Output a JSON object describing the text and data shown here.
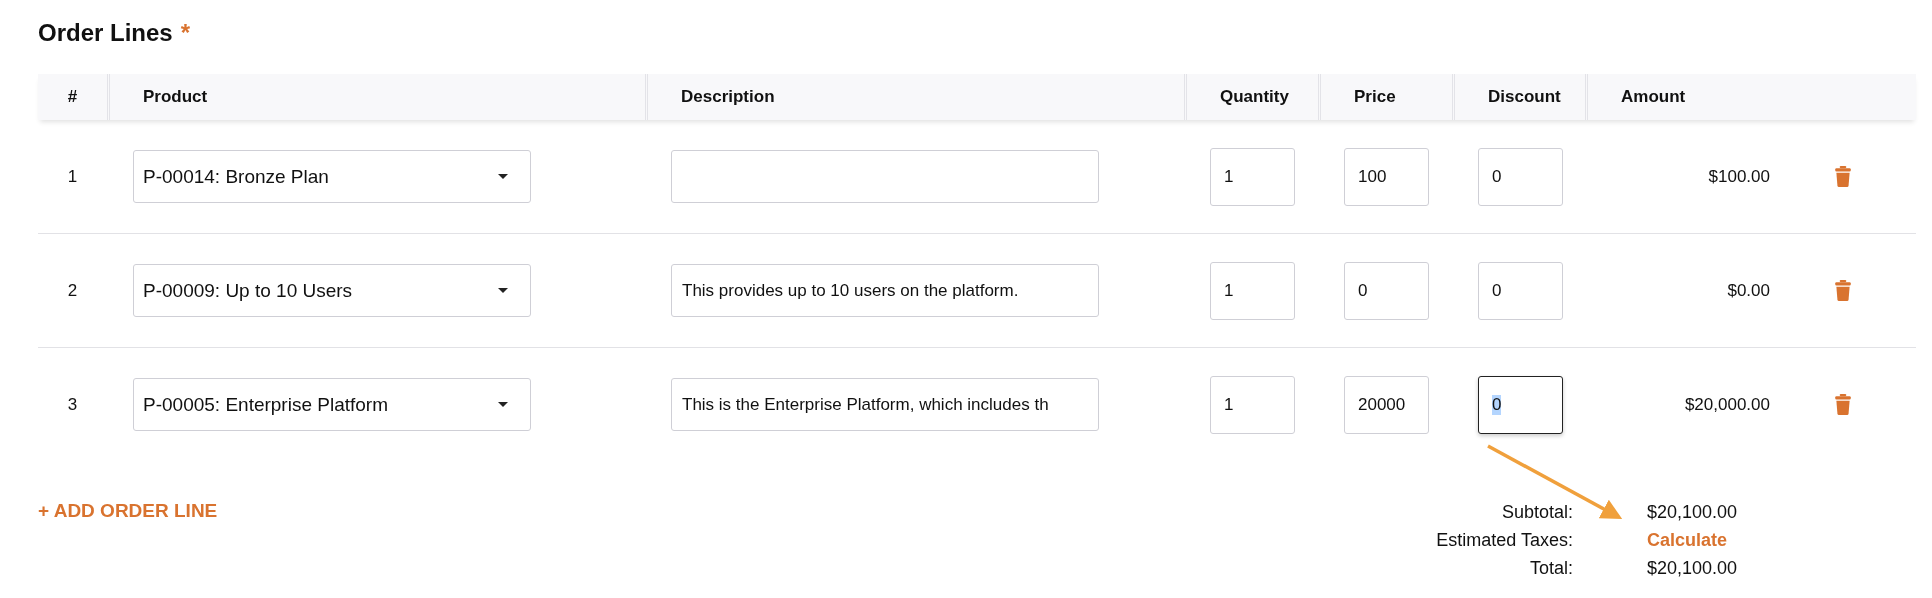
{
  "section": {
    "title": "Order Lines",
    "required_mark": "*"
  },
  "table": {
    "columns": [
      "#",
      "Product",
      "Description",
      "Quantity",
      "Price",
      "Discount",
      "Amount"
    ],
    "rows": [
      {
        "number": "1",
        "product": "P-00014: Bronze Plan",
        "quantity": "1",
        "price": "100",
        "discount": "0",
        "discount_focused": false,
        "amount": "$100.00"
      },
      {
        "number": "2",
        "product": "P-00009: Up to 10 Users",
        "description": "This provides up to 10 users on the platform.",
        "quantity": "1",
        "price": "0",
        "discount": "0",
        "discount_focused": false,
        "amount": "$0.00"
      },
      {
        "number": "3",
        "product": "P-00005: Enterprise Platform",
        "description": "This is the Enterprise Platform, which includes th",
        "quantity": "1",
        "price": "20000",
        "discount": "0",
        "discount_focused": true,
        "amount": "$20,000.00"
      }
    ]
  },
  "add_line": "+ ADD ORDER LINE",
  "totals": [
    {
      "label": "Subtotal:",
      "value": "$20,100.00",
      "kind": "amount"
    },
    {
      "label": "Estimated Taxes:",
      "value": "Calculate",
      "kind": "link"
    },
    {
      "label": "Total:",
      "value": "$20,100.00",
      "kind": "amount"
    }
  ]
}
